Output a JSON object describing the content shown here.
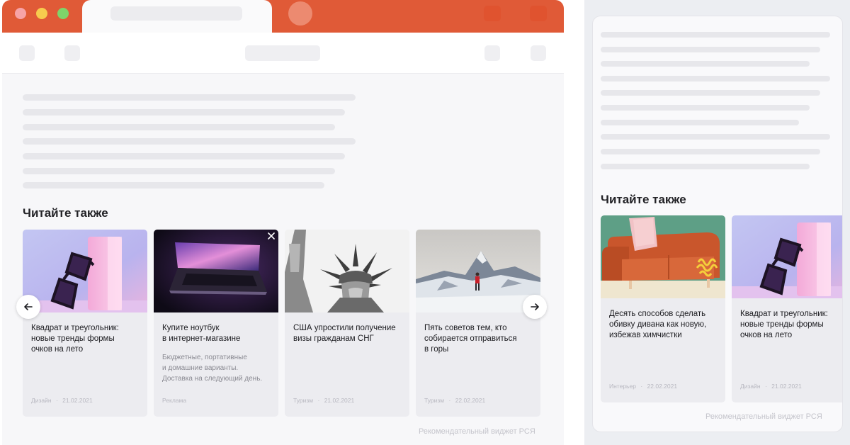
{
  "desktop": {
    "section_title": "Читайте также",
    "widget_caption": "Рекомендательный виджет РСЯ",
    "cards": [
      {
        "title": "Квадрат и треугольник:\nновые тренды формы\nочков на лето",
        "description": "",
        "category": "Дизайн",
        "date": "21.02.2021",
        "image_icon": "glasses-image"
      },
      {
        "title": "Купите ноутбук\nв интернет-магазине",
        "description": "Бюджетные, портативные\nи домашние варианты.\nДоставка на следующий день.",
        "category": "Реклама",
        "date": "",
        "image_icon": "laptop-image"
      },
      {
        "title": "США упростили получение\nвизы гражданам СНГ",
        "description": "",
        "category": "Туризм",
        "date": "21.02.2021",
        "image_icon": "statue-of-liberty-image"
      },
      {
        "title": "Пять советов тем, кто\nсобирается отправиться\nв горы",
        "description": "",
        "category": "Туризм",
        "date": "22.02.2021",
        "image_icon": "mountain-image"
      }
    ]
  },
  "mobile": {
    "section_title": "Читайте также",
    "widget_caption": "Рекомендательный виджет РСЯ",
    "cards": [
      {
        "title": "Десять способов сделать\nобивку дивана как новую,\nизбежав химчистки",
        "category": "Интерьер",
        "date": "22.02.2021",
        "image_icon": "sofa-image"
      },
      {
        "title": "Квадрат и треугольник:\nновые тренды формы\nочков на лето",
        "category": "Дизайн",
        "date": "21.02.2021",
        "image_icon": "glasses-image"
      }
    ]
  },
  "meta_separator": "·",
  "colors": {
    "browser_accent": "#e05a37",
    "card_bg": "#ececf0",
    "page_bg": "#f7f7f9"
  }
}
